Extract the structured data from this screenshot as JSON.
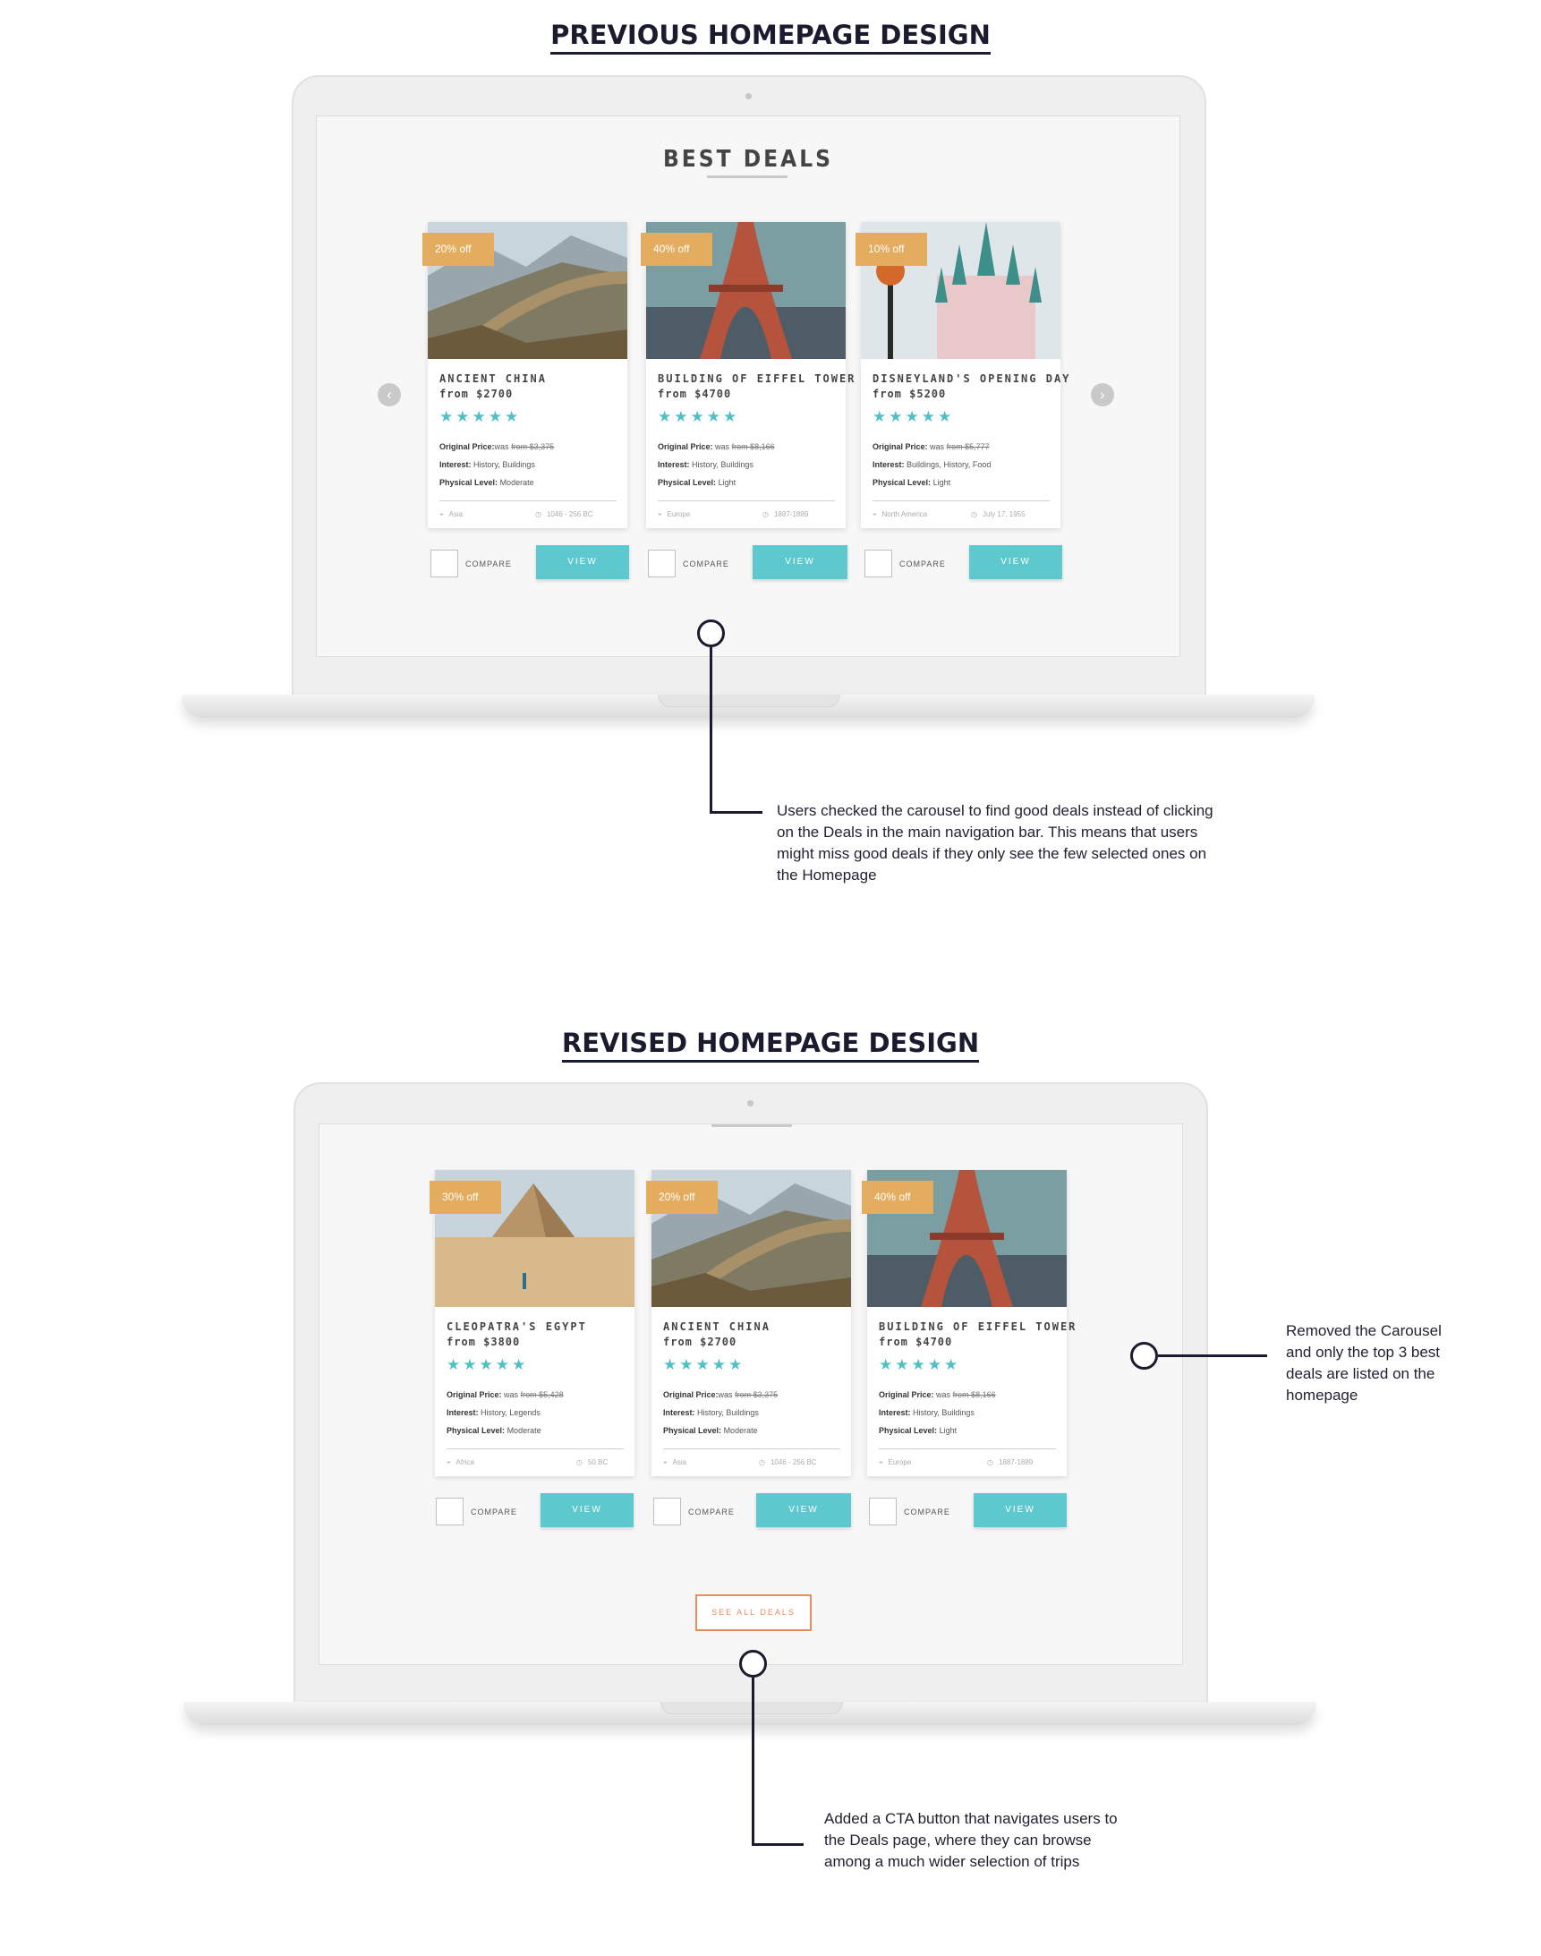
{
  "sections": {
    "previous_title": "PREVIOUS HOMEPAGE DESIGN",
    "revised_title": "REVISED HOMEPAGE DESIGN"
  },
  "previous": {
    "heading": "BEST DEALS",
    "compare_label": "COMPARE",
    "view_label": "VIEW",
    "cards": [
      {
        "badge": "20% off",
        "name": "ANCIENT CHINA",
        "price": "from $2700",
        "stars": "★★★★★",
        "orig_label": "Original Price:",
        "orig_was": "was",
        "orig_from": "from $3,375",
        "interest_label": "Interest:",
        "interest": "History, Buildings",
        "physical_label": "Physical Level:",
        "physical": "Moderate",
        "location": "Asia",
        "date": "1046 - 256 BC"
      },
      {
        "badge": "40% off",
        "name": "BUILDING OF EIFFEL TOWER",
        "price": "from $4700",
        "stars": "★★★★★",
        "orig_label": "Original Price:",
        "orig_was": "was",
        "orig_from": "from $8,166",
        "interest_label": "Interest:",
        "interest": "History, Buildings",
        "physical_label": "Physical Level:",
        "physical": "Light",
        "location": "Europe",
        "date": "1887-1889"
      },
      {
        "badge": "10% off",
        "name": "DISNEYLAND'S OPENING DAY",
        "price": "from $5200",
        "stars": "★★★★★",
        "orig_label": "Original Price:",
        "orig_was": "was",
        "orig_from": "from $5,777",
        "interest_label": "Interest:",
        "interest": "Buildings, History, Food",
        "physical_label": "Physical Level:",
        "physical": "Light",
        "location": "North America",
        "date": "July 17, 1955"
      }
    ],
    "annotation": "Users checked the carousel to find good deals instead of clicking on the Deals in the main navigation bar. This means that users might miss good deals if they only see the few selected ones on the Homepage"
  },
  "revised": {
    "compare_label": "COMPARE",
    "view_label": "VIEW",
    "see_all_label": "SEE ALL DEALS",
    "cards": [
      {
        "badge": "30% off",
        "name": "CLEOPATRA'S EGYPT",
        "price": "from $3800",
        "stars": "★★★★★",
        "orig_label": "Original Price:",
        "orig_was": "was",
        "orig_from": "from $5,428",
        "interest_label": "Interest:",
        "interest": "History, Legends",
        "physical_label": "Physical Level:",
        "physical": "Moderate",
        "location": "Africa",
        "date": "50 BC"
      },
      {
        "badge": "20% off",
        "name": "ANCIENT CHINA",
        "price": "from $2700",
        "stars": "★★★★★",
        "orig_label": "Original Price:",
        "orig_was": "was",
        "orig_from": "from $3,375",
        "interest_label": "Interest:",
        "interest": "History, Buildings",
        "physical_label": "Physical Level:",
        "physical": "Moderate",
        "location": "Asia",
        "date": "1046 - 256 BC"
      },
      {
        "badge": "40% off",
        "name": "BUILDING OF EIFFEL TOWER",
        "price": "from $4700",
        "stars": "★★★★★",
        "orig_label": "Original Price:",
        "orig_was": "was",
        "orig_from": "from $8,166",
        "interest_label": "Interest:",
        "interest": "History, Buildings",
        "physical_label": "Physical Level:",
        "physical": "Light",
        "location": "Europe",
        "date": "1887-1889"
      }
    ],
    "annotation_carousel": "Removed the Carousel and only the top 3 best deals are listed on the homepage",
    "annotation_cta": "Added a CTA button that navigates users to the Deals page, where they can browse among a much wider selection of trips"
  },
  "colors": {
    "accent_teal": "#5dc8cd",
    "badge_orange": "#e3ac5e",
    "cta_orange": "#e88d5c",
    "annotation_navy": "#1a1b2e"
  },
  "icons": [
    "location-pin-icon",
    "clock-icon",
    "chevron-left-icon",
    "chevron-right-icon"
  ]
}
